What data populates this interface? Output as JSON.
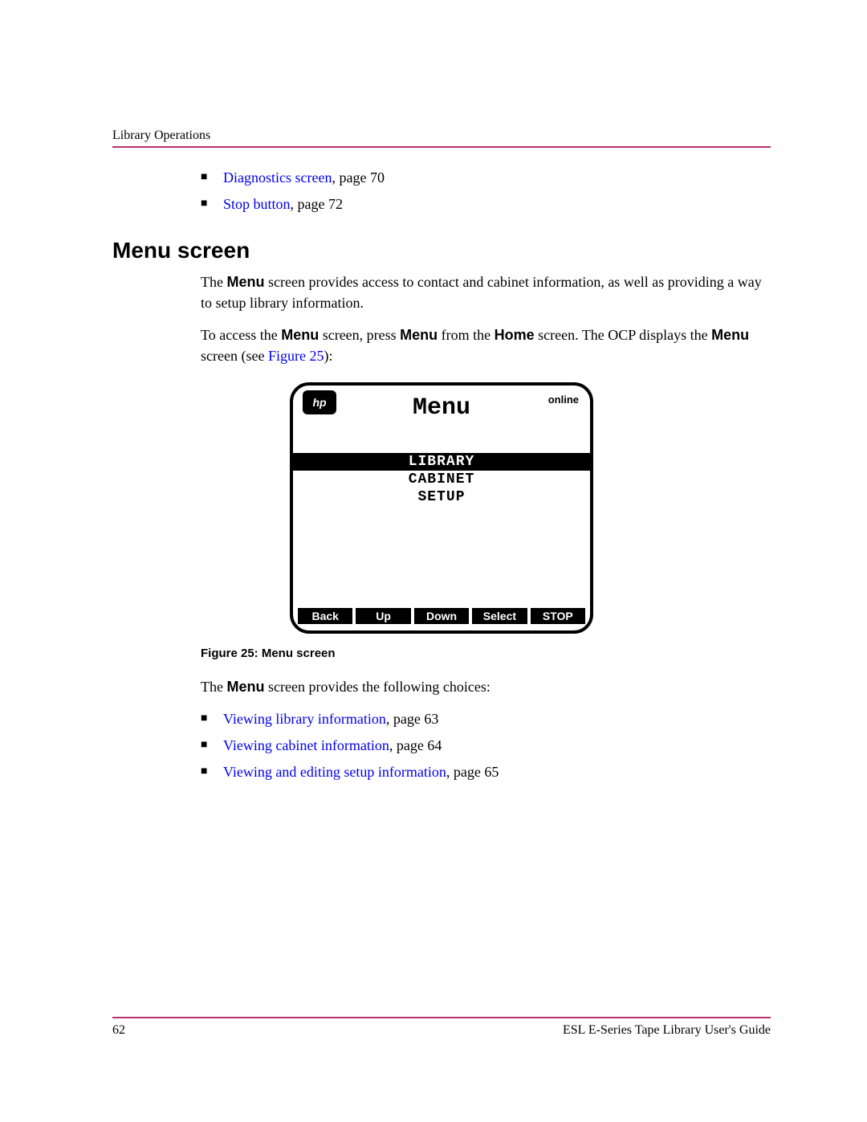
{
  "header": {
    "section": "Library Operations"
  },
  "top_bullets": [
    {
      "link": "Diagnostics screen",
      "suffix": ", page 70"
    },
    {
      "link": "Stop button",
      "suffix": ", page 72"
    }
  ],
  "heading": "Menu screen",
  "para1": {
    "pre": "The ",
    "b1": "Menu",
    "post": " screen provides access to contact and cabinet information, as well as providing a way to setup library information."
  },
  "para2": {
    "t1": "To access the ",
    "b1": "Menu",
    "t2": " screen, press ",
    "b2": "Menu",
    "t3": " from the ",
    "b3": "Home",
    "t4": " screen. The OCP displays the ",
    "b4": "Menu",
    "t5": " screen (see ",
    "link": "Figure 25",
    "t6": "):"
  },
  "ocp": {
    "logo": "hp",
    "title": "Menu",
    "status": "online",
    "items": [
      {
        "label": "LIBRARY",
        "selected": true
      },
      {
        "label": "CABINET",
        "selected": false
      },
      {
        "label": "SETUP",
        "selected": false
      }
    ],
    "buttons": [
      "Back",
      "Up",
      "Down",
      "Select",
      "STOP"
    ]
  },
  "figure_caption": "Figure 25:  Menu screen",
  "para3": {
    "t1": "The ",
    "b1": "Menu",
    "t2": " screen provides the following choices:"
  },
  "bottom_bullets": [
    {
      "link": "Viewing library information",
      "suffix": ", page 63"
    },
    {
      "link": "Viewing cabinet information",
      "suffix": ", page 64"
    },
    {
      "link": "Viewing and editing setup information",
      "suffix": ", page 65"
    }
  ],
  "footer": {
    "page": "62",
    "guide": "ESL E-Series Tape Library User's Guide"
  }
}
